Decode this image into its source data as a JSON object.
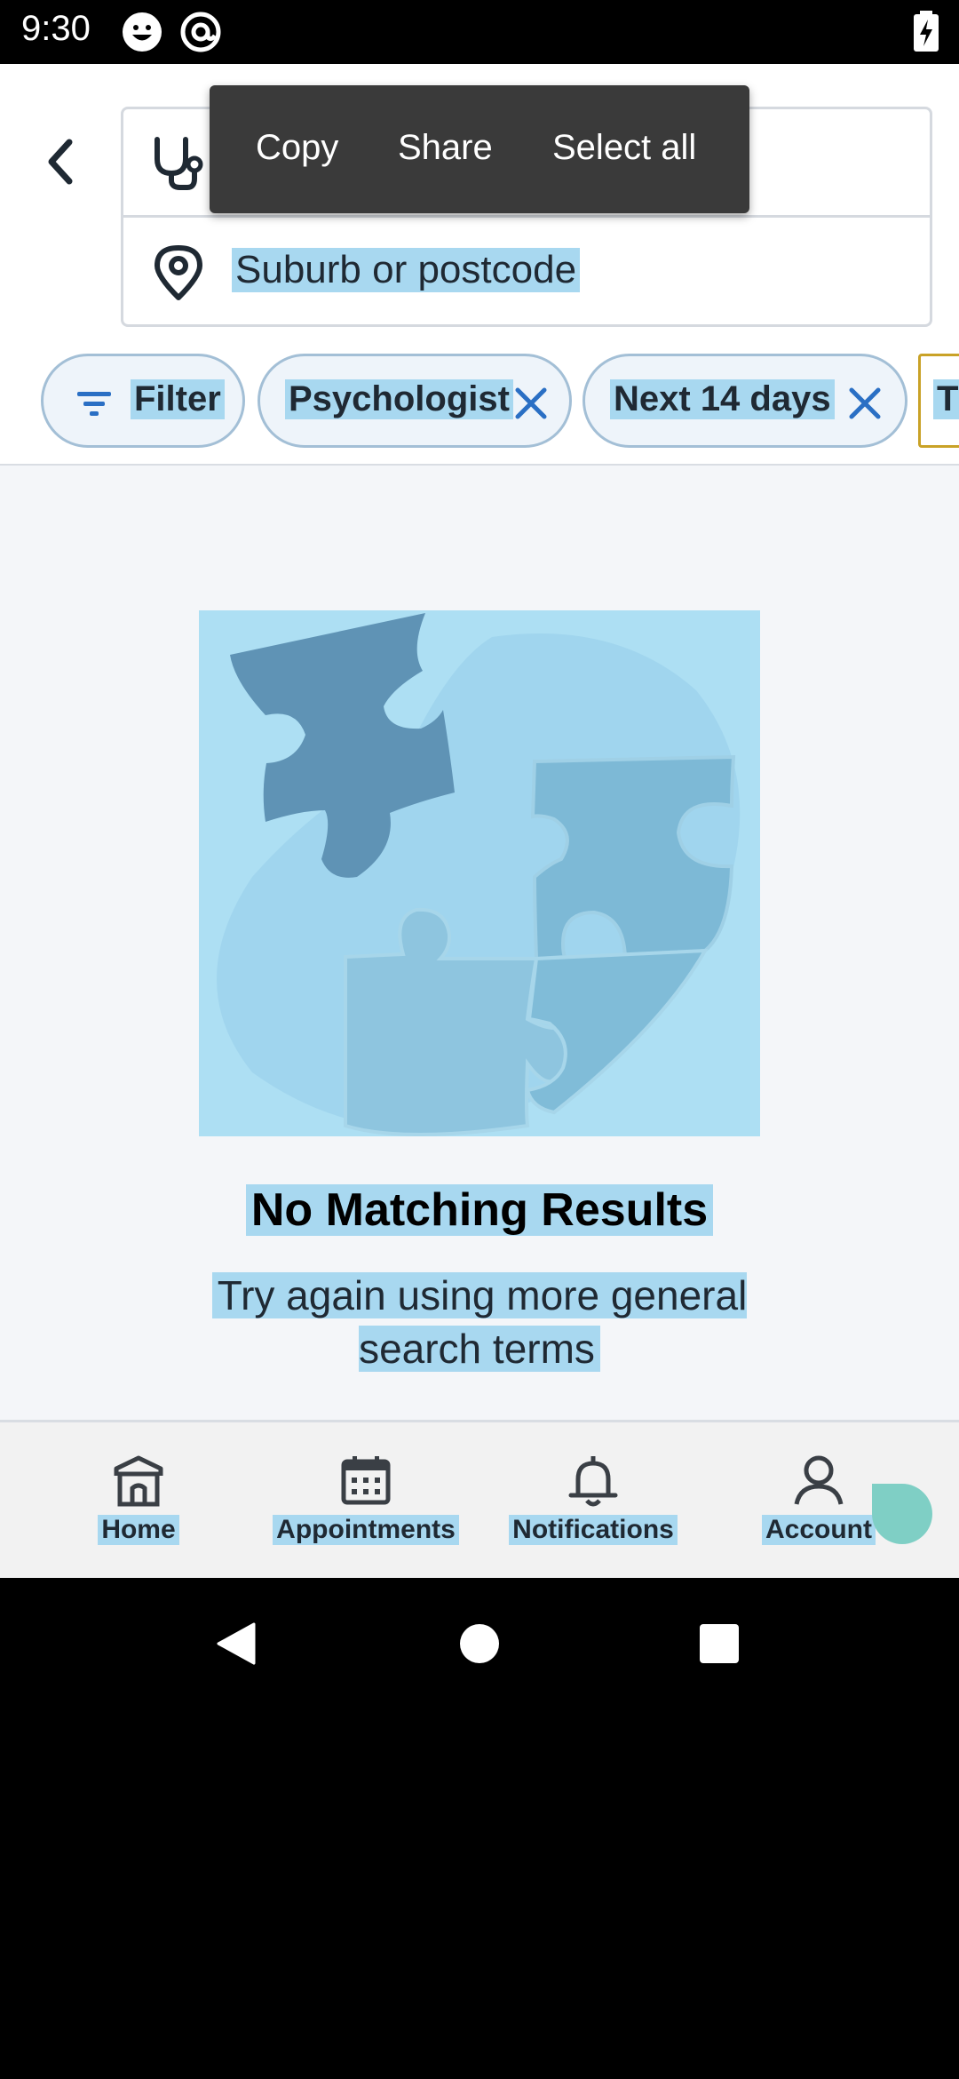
{
  "status_bar": {
    "time": "9:30",
    "icons": [
      "emoji-face-icon",
      "at-sign-icon",
      "battery-charging-icon"
    ]
  },
  "header": {
    "back_icon": "chevron-left-icon",
    "specialty_icon": "stethoscope-icon",
    "location_icon": "map-pin-icon",
    "location_placeholder": "Suburb or postcode"
  },
  "context_menu": {
    "copy": "Copy",
    "share": "Share",
    "select_all": "Select all"
  },
  "chips": [
    {
      "label": "Filter",
      "icon": "filter-icon"
    },
    {
      "label": "Psychologist",
      "icon": "close-icon"
    },
    {
      "label": "Next 14 days",
      "icon": "close-icon"
    },
    {
      "label": "T"
    }
  ],
  "empty_state": {
    "title": "No Matching Results",
    "subtitle": "Try again using more general search terms",
    "illustration": "puzzle-pieces"
  },
  "bottom_nav": [
    {
      "label": "Home",
      "icon": "home-icon"
    },
    {
      "label": "Appointments",
      "icon": "calendar-icon"
    },
    {
      "label": "Notifications",
      "icon": "bell-icon"
    },
    {
      "label": "Account",
      "icon": "person-icon"
    }
  ],
  "colors": {
    "selection": "#a8d8f0",
    "accent_blue": "#2a6fc4",
    "chip_border": "#a3bfd6",
    "context_menu_bg": "#3a3a3a",
    "handle": "#7fcfc5"
  }
}
